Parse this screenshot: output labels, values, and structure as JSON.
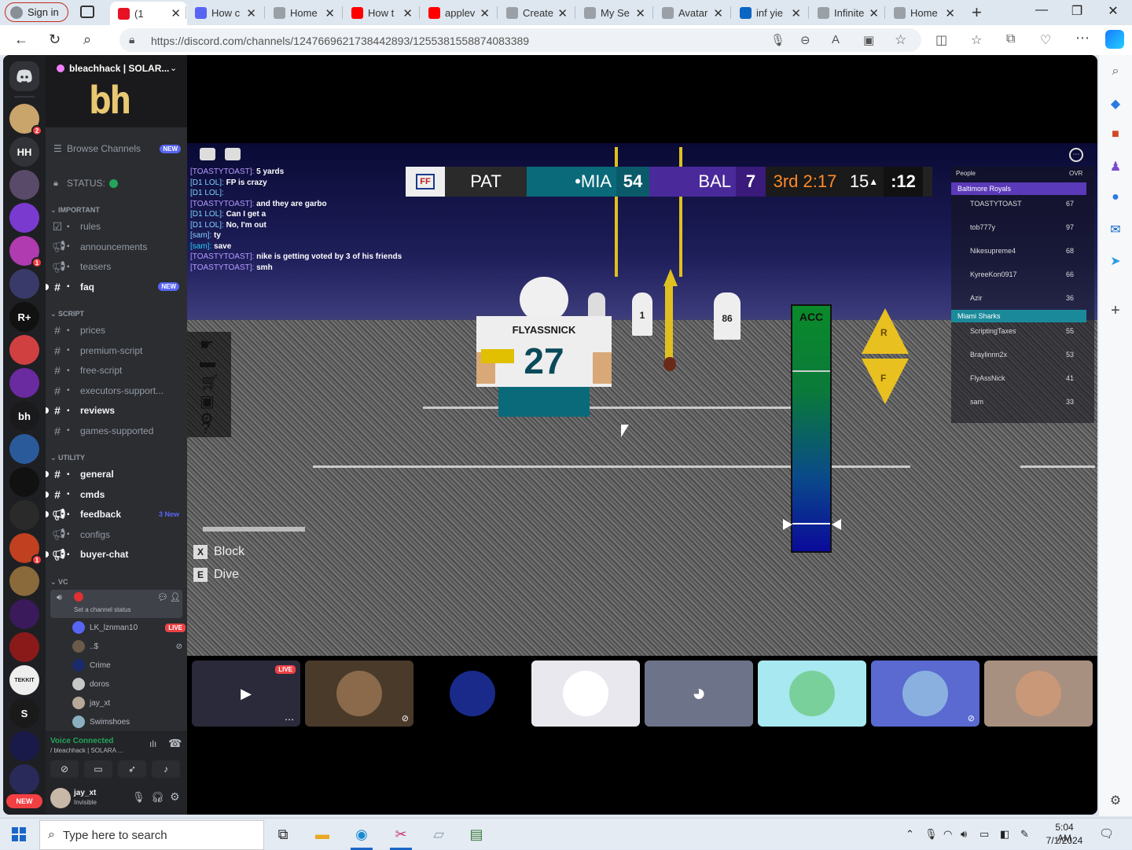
{
  "browser": {
    "signin_label": "Sign in",
    "tabs": [
      {
        "label": "(1",
        "color": "#e81123"
      },
      {
        "label": "How c",
        "color": "#5865f2"
      },
      {
        "label": "Home",
        "color": "#9aa0a6"
      },
      {
        "label": "How t",
        "color": "#ff0000"
      },
      {
        "label": "applev",
        "color": "#ff0000"
      },
      {
        "label": "Create",
        "color": "#9aa0a6"
      },
      {
        "label": "My Se",
        "color": "#9aa0a6"
      },
      {
        "label": "Avatar",
        "color": "#9aa0a6"
      },
      {
        "label": "inf yie",
        "color": "#0a66c2"
      },
      {
        "label": "Infinite",
        "color": "#9aa0a6"
      },
      {
        "label": "Home",
        "color": "#9aa0a6"
      }
    ],
    "url": "https://discord.com/channels/1247669621738442893/1255381558874083389"
  },
  "discord": {
    "server_name": "bleachhack | SOLAR...",
    "banner_text": "bh",
    "guilds": [
      {
        "label": "",
        "color": "#c9a46b",
        "badge": "2"
      },
      {
        "label": "HH",
        "color": "#313338",
        "badge": ""
      },
      {
        "label": "",
        "color": "#5a4a6a",
        "badge": ""
      },
      {
        "label": "",
        "color": "#7a3ad0",
        "badge": ""
      },
      {
        "label": "",
        "color": "#b03ab0",
        "badge": "1"
      },
      {
        "label": "",
        "color": "#3a3a6a",
        "badge": ""
      },
      {
        "label": "R+",
        "color": "#111",
        "badge": ""
      },
      {
        "label": "",
        "color": "#d04040",
        "badge": ""
      },
      {
        "label": "",
        "color": "#6a2aa0",
        "badge": ""
      },
      {
        "label": "bh",
        "color": "#1a1a1c",
        "badge": ""
      },
      {
        "label": "",
        "color": "#2a5a9a",
        "badge": ""
      },
      {
        "label": "",
        "color": "#111",
        "badge": ""
      },
      {
        "label": "",
        "color": "#2a2a2a",
        "badge": ""
      },
      {
        "label": "",
        "color": "#c04020",
        "badge": "1"
      },
      {
        "label": "",
        "color": "#8a6a3a",
        "badge": ""
      },
      {
        "label": "",
        "color": "#3a1a5a",
        "badge": ""
      },
      {
        "label": "",
        "color": "#8a1a1a",
        "badge": ""
      },
      {
        "label": "TEKKIT",
        "color": "#eee",
        "badge": ""
      },
      {
        "label": "S",
        "color": "#1a1a1a",
        "badge": ""
      },
      {
        "label": "",
        "color": "#1a1a4a",
        "badge": ""
      },
      {
        "label": "",
        "color": "#2a2a5a",
        "badge": ""
      }
    ],
    "new_label": "NEW",
    "browse_channels": "Browse Channels",
    "browse_new": "NEW",
    "status_label": "STATUS:",
    "categories": {
      "important": "IMPORTANT",
      "script": "SCRIPT",
      "utility": "UTILITY",
      "vc": "VC"
    },
    "important_channels": [
      {
        "name": "rules",
        "unread": false,
        "tag": ""
      },
      {
        "name": "announcements",
        "unread": false,
        "tag": ""
      },
      {
        "name": "teasers",
        "unread": false,
        "tag": ""
      },
      {
        "name": "faq",
        "unread": true,
        "tag": "NEW"
      }
    ],
    "script_channels": [
      {
        "name": "prices",
        "unread": false,
        "tag": ""
      },
      {
        "name": "premium-script",
        "unread": false,
        "tag": ""
      },
      {
        "name": "free-script",
        "unread": false,
        "tag": ""
      },
      {
        "name": "executors-support...",
        "unread": false,
        "tag": ""
      },
      {
        "name": "reviews",
        "unread": true,
        "tag": ""
      },
      {
        "name": "games-supported",
        "unread": false,
        "tag": ""
      }
    ],
    "utility_channels": [
      {
        "name": "general",
        "unread": true,
        "tag": ""
      },
      {
        "name": "cmds",
        "unread": true,
        "tag": ""
      },
      {
        "name": "feedback",
        "unread": true,
        "tag": "3 New"
      },
      {
        "name": "configs",
        "unread": false,
        "tag": ""
      },
      {
        "name": "buyer-chat",
        "unread": true,
        "tag": ""
      }
    ],
    "vc_status_hint": "Set a channel status",
    "vc_users": [
      {
        "name": "LK_lznman10",
        "live": "LIVE"
      },
      {
        "name": "..$",
        "live": ""
      },
      {
        "name": "Crime",
        "live": ""
      },
      {
        "name": "doros",
        "live": ""
      },
      {
        "name": "jay_xt",
        "live": ""
      },
      {
        "name": "Swimshoes",
        "live": ""
      }
    ],
    "voice_connected": "Voice Connected",
    "voice_channel": "/ bleachhack | SOLARA ...",
    "user_name": "jay_xt",
    "user_status": "Invisible"
  },
  "game": {
    "scoreboard": {
      "league": "FF",
      "play": "PAT",
      "home_team": "•MIA",
      "home_score": "54",
      "away_team": "BAL",
      "away_score": "7",
      "clock": "3rd 2:17",
      "down": "15",
      "play_clock": ":12"
    },
    "chat": [
      {
        "name": "[TOASTYTOAST]:",
        "msg": "5 yards",
        "color": "#b59cff"
      },
      {
        "name": "[D1 LOL]:",
        "msg": "FP is crazy",
        "color": "#7fd3ff"
      },
      {
        "name": "[D1 LOL]:",
        "msg": "",
        "color": "#7fd3ff"
      },
      {
        "name": "[TOASTYTOAST]:",
        "msg": "and they are garbo",
        "color": "#b59cff"
      },
      {
        "name": "[D1 LOL]:",
        "msg": "Can I get a",
        "color": "#7fd3ff"
      },
      {
        "name": "[D1 LOL]:",
        "msg": "No, I'm out",
        "color": "#7fd3ff"
      },
      {
        "name": "[sam]:",
        "msg": "ty",
        "color": "#7fd3ff"
      },
      {
        "name": "[sam]:",
        "msg": "save",
        "color": "#20d0ff"
      },
      {
        "name": "[TOASTYTOAST]:",
        "msg": "nike is getting voted by 3 of his friends",
        "color": "#b59cff"
      },
      {
        "name": "[TOASTYTOAST]:",
        "msg": "smh",
        "color": "#b59cff"
      }
    ],
    "playerlist": {
      "header_people": "People",
      "header_ovr": "OVR",
      "team1": "Baltimore Royals",
      "team1_color": "#5a3ab8",
      "team1_players": [
        {
          "name": "TOASTYTOAST",
          "ovr": "67"
        },
        {
          "name": "tob777y",
          "ovr": "97"
        },
        {
          "name": "Nikesupreme4",
          "ovr": "68"
        },
        {
          "name": "KyreeKon0917",
          "ovr": "66"
        },
        {
          "name": "Azir",
          "ovr": "36"
        }
      ],
      "team2": "Miami Sharks",
      "team2_color": "#1a8a9a",
      "team2_players": [
        {
          "name": "ScriptingTaxes",
          "ovr": "55"
        },
        {
          "name": "Braylinnn2x",
          "ovr": "53"
        },
        {
          "name": "FlyAssNick",
          "ovr": "41"
        },
        {
          "name": "sam",
          "ovr": "33"
        }
      ]
    },
    "player_name": "FLYASSNICK",
    "player_number": "27",
    "acc_label": "ACC",
    "kick_r": "R",
    "kick_f": "F",
    "keys": [
      {
        "key": "X",
        "action": "Block"
      },
      {
        "key": "E",
        "action": "Dive"
      }
    ],
    "tile_live_label": "LIVE"
  },
  "taskbar": {
    "search_placeholder": "Type here to search",
    "time": "5:04 AM",
    "date": "7/1/2024"
  }
}
